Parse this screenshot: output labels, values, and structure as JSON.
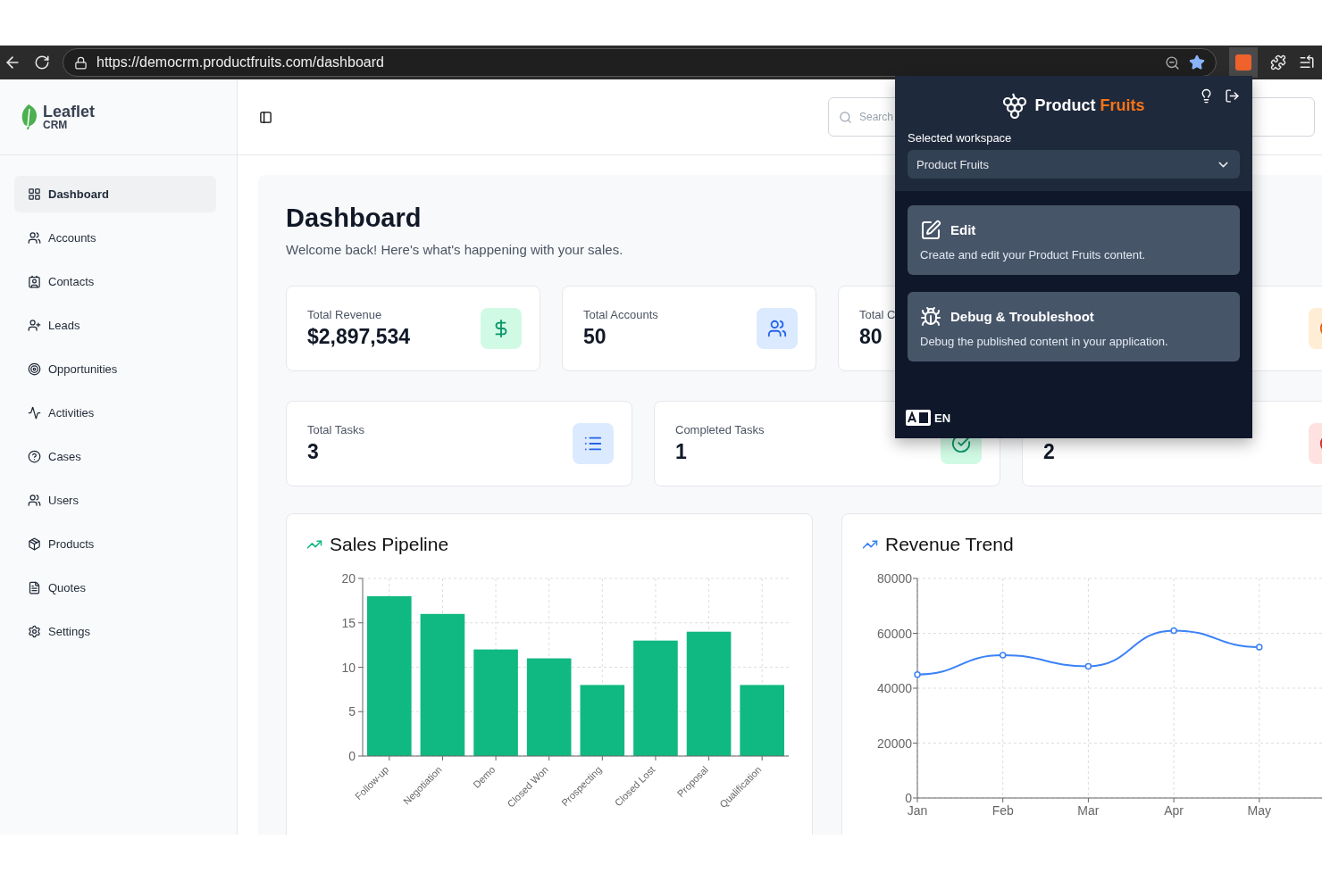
{
  "browser": {
    "url": "https://democrm.productfruits.com/dashboard"
  },
  "sidebar": {
    "logo": {
      "name": "Leaflet",
      "sub": "CRM"
    },
    "items": [
      {
        "label": "Dashboard",
        "selected": true
      },
      {
        "label": "Accounts",
        "selected": false
      },
      {
        "label": "Contacts",
        "selected": false
      },
      {
        "label": "Leads",
        "selected": false
      },
      {
        "label": "Opportunities",
        "selected": false
      },
      {
        "label": "Activities",
        "selected": false
      },
      {
        "label": "Cases",
        "selected": false
      },
      {
        "label": "Users",
        "selected": false
      },
      {
        "label": "Products",
        "selected": false
      },
      {
        "label": "Quotes",
        "selected": false
      },
      {
        "label": "Settings",
        "selected": false
      }
    ]
  },
  "header": {
    "search_placeholder": "Search"
  },
  "page": {
    "title": "Dashboard",
    "subtitle": "Welcome back! Here's what's happening with your sales."
  },
  "stats_rows": [
    [
      {
        "kind": "stat",
        "label": "Total Revenue",
        "value": "$2,897,534"
      },
      {
        "kind": "stat",
        "label": "Total Accounts",
        "value": "50"
      },
      {
        "kind": "stat",
        "label": "Total C",
        "value": "80"
      },
      {
        "kind": "icon_only"
      }
    ],
    [
      {
        "kind": "stat",
        "label": "Total Tasks",
        "value": "3"
      },
      {
        "kind": "stat",
        "label": "Completed Tasks",
        "value": "1"
      },
      {
        "kind": "stat",
        "value": "2"
      }
    ]
  ],
  "charts": [
    {
      "title": "Sales Pipeline",
      "chart_data": {
        "type": "bar",
        "categories": [
          "Follow-up",
          "Negotiation",
          "Demo",
          "Closed Won",
          "Prospecting",
          "Closed Lost",
          "Proposal",
          "Qualification"
        ],
        "series": [
          {
            "color": "#10b981",
            "values": [
              18,
              16,
              12,
              11,
              8,
              13,
              14,
              8
            ]
          }
        ],
        "ylim": [
          0,
          20
        ],
        "yticks": [
          0,
          5,
          10,
          15,
          20
        ],
        "grid": true
      }
    },
    {
      "title": "Revenue Trend",
      "chart_data": {
        "type": "line",
        "categories": [
          "Jan",
          "Feb",
          "Mar",
          "Apr",
          "May"
        ],
        "series": [
          {
            "color": "#3b82f6",
            "values": [
              45000,
              52000,
              48000,
              61000,
              55000
            ],
            "marker": "circle"
          }
        ],
        "ylim": [
          0,
          80000
        ],
        "yticks": [
          0,
          20000,
          40000,
          60000,
          80000
        ],
        "grid": true
      }
    }
  ],
  "popup": {
    "brand": {
      "first": "Product",
      "accent": "Fruits"
    },
    "workspace_label": "Selected workspace",
    "workspace": "Product Fruits",
    "actions": [
      {
        "title": "Edit",
        "description": "Create and edit your Product Fruits content."
      },
      {
        "title": "Debug & Troubleshoot",
        "description": "Debug the published content in your application."
      }
    ],
    "language": "EN"
  }
}
